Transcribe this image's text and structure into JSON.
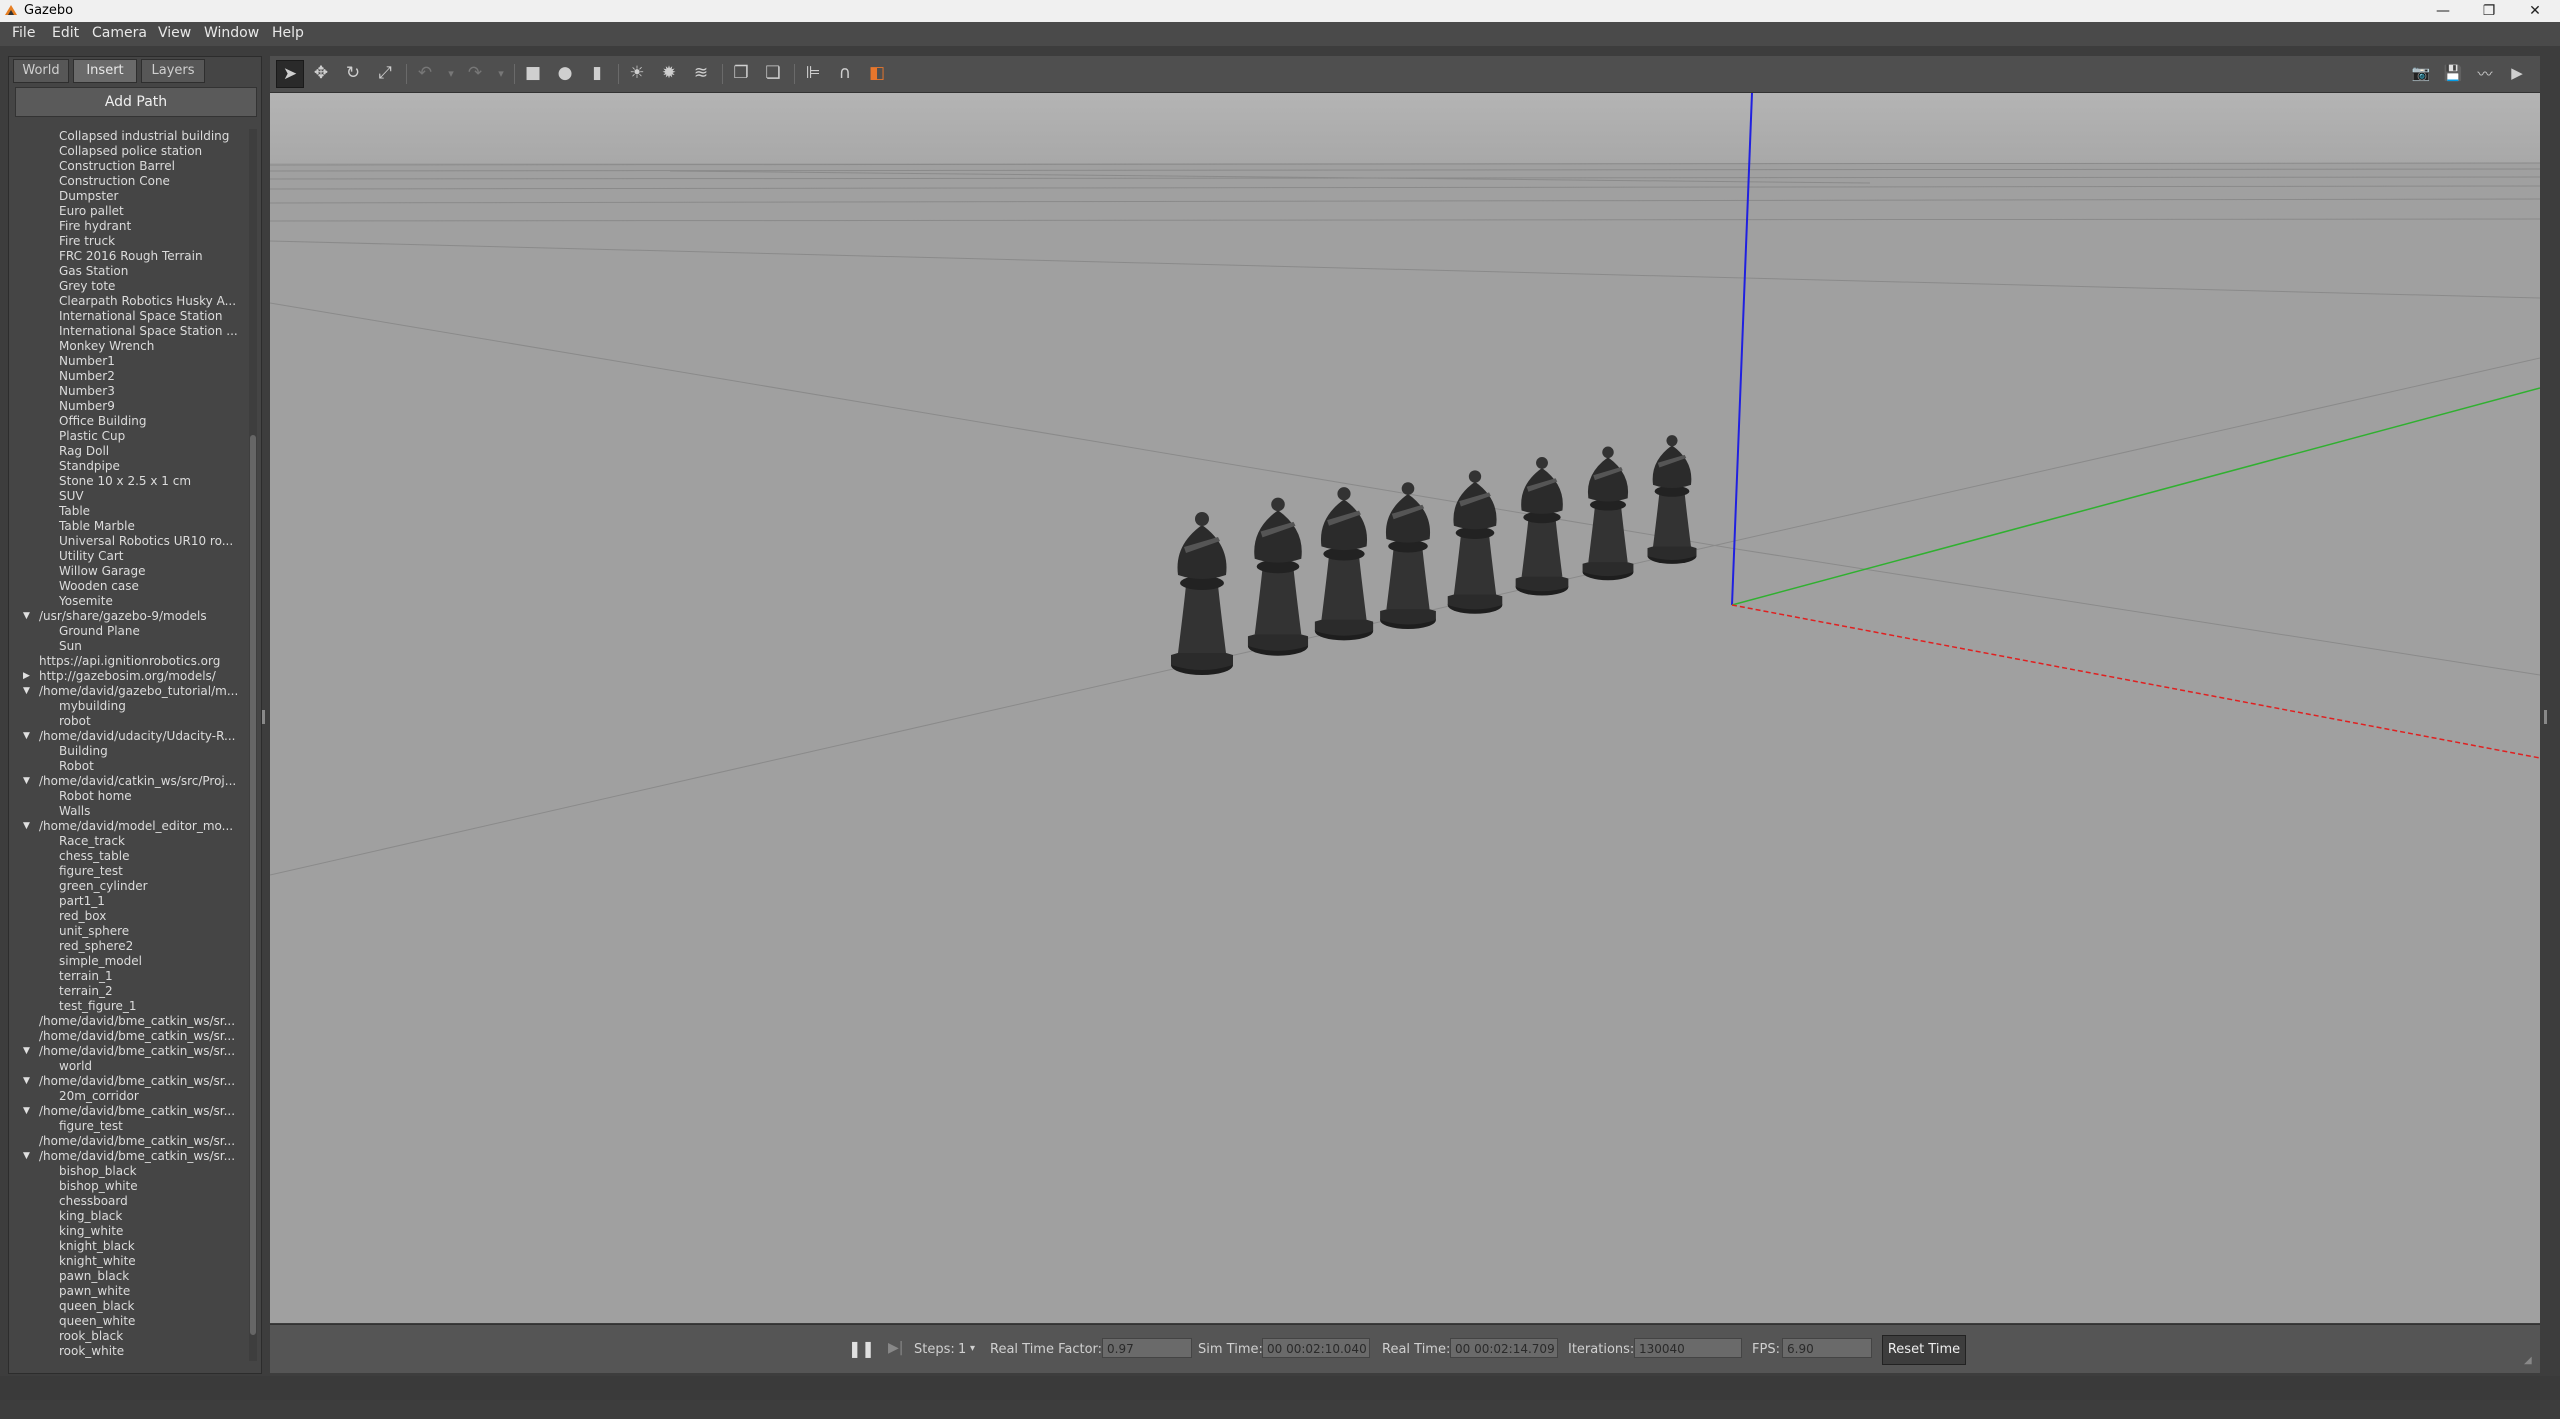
{
  "window": {
    "title": "Gazebo",
    "controls": [
      "—",
      "❐",
      "✕"
    ]
  },
  "menu": [
    {
      "label": "File"
    },
    {
      "label": "Edit"
    },
    {
      "label": "Camera"
    },
    {
      "label": "View"
    },
    {
      "label": "Window"
    },
    {
      "label": "Help"
    }
  ],
  "left_panel": {
    "tabs": [
      {
        "label": "World"
      },
      {
        "label": "Insert"
      },
      {
        "label": "Layers"
      }
    ],
    "active_tab": "Insert",
    "add_path_label": "Add Path",
    "rows": [
      {
        "kind": "item",
        "label": "Collapsed industrial building"
      },
      {
        "kind": "item",
        "label": "Collapsed police station"
      },
      {
        "kind": "item",
        "label": "Construction Barrel"
      },
      {
        "kind": "item",
        "label": "Construction Cone"
      },
      {
        "kind": "item",
        "label": "Dumpster"
      },
      {
        "kind": "item",
        "label": "Euro pallet"
      },
      {
        "kind": "item",
        "label": "Fire hydrant"
      },
      {
        "kind": "item",
        "label": "Fire truck"
      },
      {
        "kind": "item",
        "label": "FRC 2016 Rough Terrain"
      },
      {
        "kind": "item",
        "label": "Gas Station"
      },
      {
        "kind": "item",
        "label": "Grey tote"
      },
      {
        "kind": "item",
        "label": "Clearpath Robotics Husky A..."
      },
      {
        "kind": "item",
        "label": "International Space Station"
      },
      {
        "kind": "item",
        "label": "International Space Station ..."
      },
      {
        "kind": "item",
        "label": "Monkey Wrench"
      },
      {
        "kind": "item",
        "label": "Number1"
      },
      {
        "kind": "item",
        "label": "Number2"
      },
      {
        "kind": "item",
        "label": "Number3"
      },
      {
        "kind": "item",
        "label": "Number9"
      },
      {
        "kind": "item",
        "label": "Office Building"
      },
      {
        "kind": "item",
        "label": "Plastic Cup"
      },
      {
        "kind": "item",
        "label": "Rag Doll"
      },
      {
        "kind": "item",
        "label": "Standpipe"
      },
      {
        "kind": "item",
        "label": "Stone 10 x 2.5 x 1 cm"
      },
      {
        "kind": "item",
        "label": "SUV"
      },
      {
        "kind": "item",
        "label": "Table"
      },
      {
        "kind": "item",
        "label": "Table Marble"
      },
      {
        "kind": "item",
        "label": "Universal Robotics UR10 ro..."
      },
      {
        "kind": "item",
        "label": "Utility Cart"
      },
      {
        "kind": "item",
        "label": "Willow Garage"
      },
      {
        "kind": "item",
        "label": "Wooden case"
      },
      {
        "kind": "item",
        "label": "Yosemite"
      },
      {
        "kind": "group",
        "arrow": "down",
        "label": "/usr/share/gazebo-9/models"
      },
      {
        "kind": "item",
        "label": "Ground Plane"
      },
      {
        "kind": "item",
        "label": "Sun"
      },
      {
        "kind": "group",
        "arrow": "none",
        "label": "https://api.ignitionrobotics.org"
      },
      {
        "kind": "group",
        "arrow": "right",
        "label": "http://gazebosim.org/models/"
      },
      {
        "kind": "group",
        "arrow": "down",
        "label": "/home/david/gazebo_tutorial/m..."
      },
      {
        "kind": "item",
        "label": "mybuilding"
      },
      {
        "kind": "item",
        "label": "robot"
      },
      {
        "kind": "group",
        "arrow": "down",
        "label": "/home/david/udacity/Udacity-R..."
      },
      {
        "kind": "item",
        "label": "Building"
      },
      {
        "kind": "item",
        "label": "Robot"
      },
      {
        "kind": "group",
        "arrow": "down",
        "label": "/home/david/catkin_ws/src/Proj..."
      },
      {
        "kind": "item",
        "label": "Robot home"
      },
      {
        "kind": "item",
        "label": "Walls"
      },
      {
        "kind": "group",
        "arrow": "down",
        "label": "/home/david/model_editor_mo..."
      },
      {
        "kind": "item",
        "label": "Race_track"
      },
      {
        "kind": "item",
        "label": "chess_table"
      },
      {
        "kind": "item",
        "label": "figure_test"
      },
      {
        "kind": "item",
        "label": "green_cylinder"
      },
      {
        "kind": "item",
        "label": "part1_1"
      },
      {
        "kind": "item",
        "label": "red_box"
      },
      {
        "kind": "item",
        "label": "unit_sphere"
      },
      {
        "kind": "item",
        "label": "red_sphere2"
      },
      {
        "kind": "item",
        "label": "simple_model"
      },
      {
        "kind": "item",
        "label": "terrain_1"
      },
      {
        "kind": "item",
        "label": "terrain_2"
      },
      {
        "kind": "item",
        "label": "test_figure_1"
      },
      {
        "kind": "group",
        "arrow": "none",
        "label": "/home/david/bme_catkin_ws/sr..."
      },
      {
        "kind": "group",
        "arrow": "none",
        "label": "/home/david/bme_catkin_ws/sr..."
      },
      {
        "kind": "group",
        "arrow": "down",
        "label": "/home/david/bme_catkin_ws/sr..."
      },
      {
        "kind": "item",
        "label": "world"
      },
      {
        "kind": "group",
        "arrow": "down",
        "label": "/home/david/bme_catkin_ws/sr..."
      },
      {
        "kind": "item",
        "label": "20m_corridor"
      },
      {
        "kind": "group",
        "arrow": "down",
        "label": "/home/david/bme_catkin_ws/sr..."
      },
      {
        "kind": "item",
        "label": "figure_test"
      },
      {
        "kind": "group",
        "arrow": "none",
        "label": "/home/david/bme_catkin_ws/sr..."
      },
      {
        "kind": "group",
        "arrow": "down",
        "label": "/home/david/bme_catkin_ws/sr..."
      },
      {
        "kind": "item",
        "label": "bishop_black"
      },
      {
        "kind": "item",
        "label": "bishop_white"
      },
      {
        "kind": "item",
        "label": "chessboard"
      },
      {
        "kind": "item",
        "label": "king_black"
      },
      {
        "kind": "item",
        "label": "king_white"
      },
      {
        "kind": "item",
        "label": "knight_black"
      },
      {
        "kind": "item",
        "label": "knight_white"
      },
      {
        "kind": "item",
        "label": "pawn_black"
      },
      {
        "kind": "item",
        "label": "pawn_white"
      },
      {
        "kind": "item",
        "label": "queen_black"
      },
      {
        "kind": "item",
        "label": "queen_white"
      },
      {
        "kind": "item",
        "label": "rook_black"
      },
      {
        "kind": "item",
        "label": "rook_white"
      }
    ]
  },
  "toolbar": {
    "left_tools": [
      {
        "name": "select-mode-icon",
        "glyph": "➤",
        "selected": true
      },
      {
        "name": "translate-mode-icon",
        "glyph": "✥"
      },
      {
        "name": "rotate-mode-icon",
        "glyph": "↻"
      },
      {
        "name": "scale-mode-icon",
        "glyph": "⤢"
      },
      {
        "name": "sep"
      },
      {
        "name": "undo-icon",
        "glyph": "↶",
        "dim": true
      },
      {
        "name": "undo-history-icon",
        "glyph": "▾",
        "dim": true
      },
      {
        "name": "redo-icon",
        "glyph": "↷",
        "dim": true
      },
      {
        "name": "redo-history-icon",
        "glyph": "▾",
        "dim": true
      },
      {
        "name": "sep"
      },
      {
        "name": "box-shape-icon",
        "glyph": "■"
      },
      {
        "name": "sphere-shape-icon",
        "glyph": "●"
      },
      {
        "name": "cylinder-shape-icon",
        "glyph": "▮"
      },
      {
        "name": "sep"
      },
      {
        "name": "point-light-icon",
        "glyph": "☀"
      },
      {
        "name": "spot-light-icon",
        "glyph": "✹"
      },
      {
        "name": "directional-light-icon",
        "glyph": "≋"
      },
      {
        "name": "sep"
      },
      {
        "name": "copy-icon",
        "glyph": "❐"
      },
      {
        "name": "paste-icon",
        "glyph": "❏"
      },
      {
        "name": "sep"
      },
      {
        "name": "align-icon",
        "glyph": "⊫"
      },
      {
        "name": "snap-icon",
        "glyph": "∩"
      },
      {
        "name": "change-view-icon",
        "glyph": "◧"
      }
    ],
    "right_tools": [
      {
        "name": "screenshot-icon",
        "glyph": "📷"
      },
      {
        "name": "log-data-icon",
        "glyph": "💾"
      },
      {
        "name": "plot-icon",
        "glyph": "〰"
      },
      {
        "name": "video-record-icon",
        "glyph": "▶"
      }
    ]
  },
  "status": {
    "pause_icon": "❚❚",
    "step_icon": "▶|",
    "steps_label": "Steps:",
    "steps_value": "1",
    "rtf_label": "Real Time Factor:",
    "rtf_value": "0.97",
    "sim_time_label": "Sim Time:",
    "sim_time_value": "00 00:02:10.040",
    "real_time_label": "Real Time:",
    "real_time_value": "00 00:02:14.709",
    "iterations_label": "Iterations:",
    "iterations_value": "130040",
    "fps_label": "FPS:",
    "fps_value": "6.90",
    "reset_time_label": "Reset Time"
  },
  "colors": {
    "viewport_bg": "#a0a0a0",
    "axis_z": "#2020e0",
    "axis_y": "#30b030",
    "axis_x": "#e02020",
    "piece": "#2b2b2b"
  }
}
